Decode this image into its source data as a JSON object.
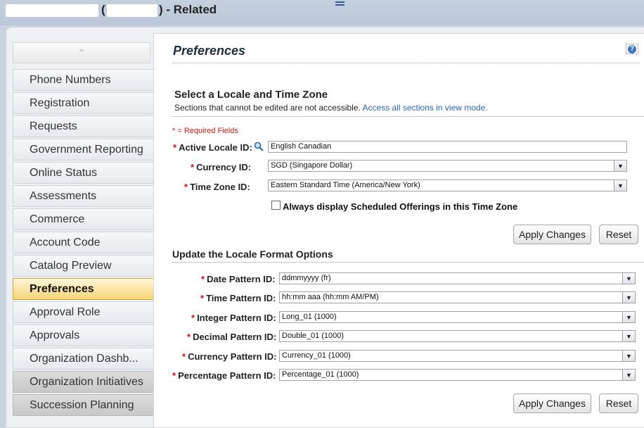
{
  "window": {
    "title_open_paren": "(",
    "title_suffix": ") - Related"
  },
  "sidebar": {
    "items": [
      {
        "label": "Phone Numbers"
      },
      {
        "label": "Registration"
      },
      {
        "label": "Requests"
      },
      {
        "label": "Government Reporting"
      },
      {
        "label": "Online Status"
      },
      {
        "label": "Assessments"
      },
      {
        "label": "Commerce"
      },
      {
        "label": "Account Code"
      },
      {
        "label": "Catalog Preview"
      },
      {
        "label": "Preferences"
      },
      {
        "label": "Approval Role"
      },
      {
        "label": "Approvals"
      },
      {
        "label": "Organization Dashb..."
      },
      {
        "label": "Organization Initiatives"
      },
      {
        "label": "Succession Planning"
      }
    ],
    "active": "Preferences"
  },
  "main": {
    "title": "Preferences",
    "help_icon": "?",
    "locale_section": {
      "heading": "Select a Locale and Time Zone",
      "description": "Sections that cannot be edited are not accessible.",
      "view_mode_link": "Access all sections in view mode.",
      "required_note": "* = Required Fields",
      "fields": {
        "active_locale": {
          "label": "Active Locale ID:",
          "value": "English Canadian"
        },
        "currency": {
          "label": "Currency ID:",
          "value": "SGD (Singapore Dollar)"
        },
        "time_zone": {
          "label": "Time Zone ID:",
          "value": "Eastern Standard Time (America/New York)"
        }
      },
      "checkbox_label": "Always display Scheduled Offerings in this Time Zone",
      "apply_label": "Apply Changes",
      "reset_label": "Reset"
    },
    "format_section": {
      "heading": "Update the Locale Format Options",
      "fields": {
        "date_pattern": {
          "label": "Date Pattern ID:",
          "value": "ddmmyyyy (fr)"
        },
        "time_pattern": {
          "label": "Time Pattern ID:",
          "value": "hh:mm aaa (hh:mm AM/PM)"
        },
        "integer_pattern": {
          "label": "Integer Pattern ID:",
          "value": "Long_01 (1000)"
        },
        "decimal_pattern": {
          "label": "Decimal Pattern ID:",
          "value": "Double_01 (1000)"
        },
        "currency_pattern": {
          "label": "Currency Pattern ID:",
          "value": "Currency_01 (1000)"
        },
        "percentage_pattern": {
          "label": "Percentage Pattern ID:",
          "value": "Percentage_01 (1000)"
        }
      },
      "apply_label": "Apply Changes",
      "reset_label": "Reset"
    }
  },
  "colors": {
    "active_tab": "#f6d476",
    "required": "#d01010",
    "link": "#2a64b8"
  }
}
